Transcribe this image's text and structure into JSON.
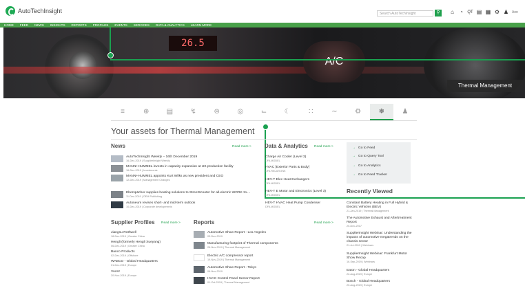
{
  "header": {
    "logo_text": "AutoTechInsight",
    "search_placeholder": "Search AutoTechInsight",
    "search_icon": "search-icon",
    "user_label": "Ann",
    "icons": [
      "home-icon",
      "history-icon",
      "qt-icon",
      "list-icon",
      "grid-icon",
      "gear-icon",
      "user-icon"
    ]
  },
  "nav": [
    "HOME",
    "FEED",
    "NEWS",
    "INSIGHTS",
    "REPORTS",
    "PROFILES",
    "EVENTS",
    "SERVICES",
    "DATA & ANALYTICS",
    "LEARN MORE"
  ],
  "hero": {
    "label": "Thermal Management",
    "display": "26.5",
    "ac_text": "A/C"
  },
  "domain_icons": [
    "powertrain-icon",
    "wheel-icon",
    "battery-icon",
    "electric-icon",
    "chassis-icon",
    "safety-icon",
    "seat-icon",
    "lighting-icon",
    "network-icon",
    "body-icon",
    "engine-icon",
    "thermal-icon",
    "interior-icon"
  ],
  "page_title": "Your assets for Thermal Management",
  "news": {
    "title": "News",
    "read_more": "Read more >",
    "items": [
      {
        "title": "AutoTechInsight Weekly – 16th December 2019",
        "meta": "16-Dec-2019  |  SupplierInsight Weekly"
      },
      {
        "title": "MANN+HUMMEL invests in capacity expansion at US production facility",
        "meta": "16-Dec-2019  |  Investments"
      },
      {
        "title": "MANN+HUMMEL appoints Kurt Wilks as new president and CEO",
        "meta": "12-Dec-2019  |  Management Changes"
      },
      {
        "title": "Eberspächer supplies heating solutions to StreetScooter for all-electric WORK XL...",
        "meta": "11-Dec-2019  |  OEM Publishing"
      },
      {
        "title": "Autoneum revises short- and mid-term outlook",
        "meta": "10-Dec-2019  |  Corporate developments"
      }
    ]
  },
  "data_analytics": {
    "title": "Data & Analytics",
    "read_more": "Read more >",
    "items": [
      {
        "title": "Charge Air Cooler (Level 3)",
        "meta": "DFA MODEL"
      },
      {
        "title": "HVAC [Exterior Parts & Body]",
        "meta": "DFA RELATIONS"
      },
      {
        "title": "HEV-T Elec Heat Exchangers",
        "meta": "DFA MODEL"
      },
      {
        "title": "HEV-T E Motor and Electronics (Level 3)",
        "meta": "DFA MODEL"
      },
      {
        "title": "HEV-T HVAC Heat Pump Condenser",
        "meta": "DFA MODEL"
      }
    ]
  },
  "quick_links": [
    "Go to Feed",
    "Go to Query Tool",
    "Go to Analytics",
    "Go to Feed Tracker"
  ],
  "recently_viewed": {
    "title": "Recently Viewed",
    "items": [
      {
        "title": "Constant Battery Heating in Full Hybrid & Electric Vehicles (BEV)",
        "meta": "21-Jan-2019  |  Thermal Management"
      },
      {
        "title": "The Automotive Exhaust and Aftertreatment Report",
        "meta": "20-Dec-2017"
      },
      {
        "title": "SupplierInsight Webinar: Understanding the impacts of automotive megatrends on the chassis sector",
        "meta": "21-Jul-2019  |  Webinars"
      },
      {
        "title": "SupplierInsight Webinar: Frankfurt Motor Show Recap",
        "meta": "16-Sep-2019  |  Webinars"
      },
      {
        "title": "Eaton - Global Headquarters",
        "meta": "22-Aug-2019  |  Europe"
      },
      {
        "title": "Bosch - Global Headquarters",
        "meta": "20-Aug-2019  |  Europe"
      }
    ]
  },
  "supplier_profiles": {
    "title": "Supplier Profiles",
    "read_more": "Read more >",
    "items": [
      {
        "title": "Jiangsu Rothwell",
        "meta": "18-Dec-2019  |  Greater China"
      },
      {
        "title": "Hengli (formerly Hengli Xueyang)",
        "meta": "06-Dec-2019  |  Greater China"
      },
      {
        "title": "Banco Products",
        "meta": "02-Dec-2019  |  Offshore"
      },
      {
        "title": "WABCO - Global Headquarters",
        "meta": "01-Dec-2019  |  Europe"
      },
      {
        "title": "Vocsz",
        "meta": "20-Nov-2019  |  Europe"
      }
    ]
  },
  "reports": {
    "title": "Reports",
    "read_more": "Read more >",
    "items": [
      {
        "title": "Automotive Show Report - Los Angeles",
        "meta": "03-Dec-2019"
      },
      {
        "title": "Manufacturing footprint of Thermal components",
        "meta": "26-Nov-2019  |  Thermal Management"
      },
      {
        "title": "Electric A/C compressor report",
        "meta": "19-Nov-2019  |  Thermal Management"
      },
      {
        "title": "Automotive Show Report - Tokyo",
        "meta": "06-Nov-2019"
      },
      {
        "title": "HVAC Control Panel Sector Report",
        "meta": "01-Oct-2019  |  Thermal Management"
      }
    ]
  }
}
